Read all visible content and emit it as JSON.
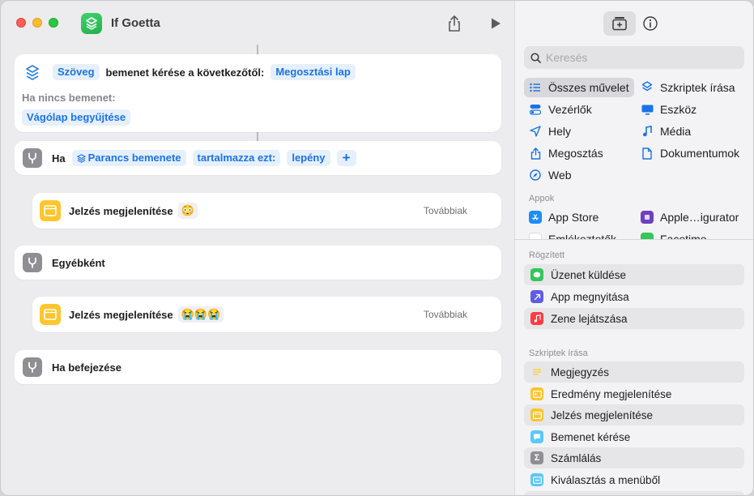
{
  "window": {
    "title": "If Goetta"
  },
  "editor": {
    "ask_input": {
      "type_token": "Szöveg",
      "text": "bemenet kérése a következőtől:",
      "source_token": "Megosztási lap",
      "no_input_label": "Ha nincs bemenet:",
      "no_input_token": "Vágólap begyűjtése"
    },
    "if_block": {
      "label": "Ha",
      "param_token": "Parancs bemenete",
      "condition_token": "tartalmazza ezt:",
      "value_token": "lepény",
      "add_label": "+"
    },
    "alert1": {
      "label": "Jelzés megjelenítése",
      "emoji": "😳",
      "more": "Továbbiak"
    },
    "otherwise": {
      "label": "Egyébként"
    },
    "alert2": {
      "label": "Jelzés megjelenítése",
      "emoji": "😭😭😭",
      "more": "Továbbiak"
    },
    "end_if": {
      "label": "Ha befejezése"
    }
  },
  "sidebar": {
    "search_placeholder": "Keresés",
    "categories": [
      {
        "label": "Összes művelet",
        "icon": "list-icon"
      },
      {
        "label": "Szkriptek írása",
        "icon": "script-icon"
      },
      {
        "label": "Vezérlők",
        "icon": "toggle-icon"
      },
      {
        "label": "Eszköz",
        "icon": "display-icon"
      },
      {
        "label": "Hely",
        "icon": "location-icon"
      },
      {
        "label": "Média",
        "icon": "music-note-icon"
      },
      {
        "label": "Megosztás",
        "icon": "share-icon"
      },
      {
        "label": "Dokumentumok",
        "icon": "document-icon"
      },
      {
        "label": "Web",
        "icon": "compass-icon"
      }
    ],
    "apps_header": "Appok",
    "apps": [
      {
        "label": "App Store",
        "icon": "app-store-icon"
      },
      {
        "label": "Apple…igurator",
        "icon": "configurator-icon"
      },
      {
        "label": "Emlékeztetők",
        "icon": "reminders-icon"
      },
      {
        "label": "Facetime",
        "icon": "facetime-icon"
      }
    ],
    "pinned_header": "Rögzített",
    "pinned": [
      {
        "label": "Üzenet küldése",
        "color": "#34c759"
      },
      {
        "label": "App megnyitása",
        "color": "#5e5ce6"
      },
      {
        "label": "Zene lejátszása",
        "color": "#fc3c44"
      }
    ],
    "scripting_header": "Szkriptek írása",
    "scripting": [
      {
        "label": "Megjegyzés",
        "color": "#f5d04a"
      },
      {
        "label": "Eredmény megjelenítése",
        "color": "#fec62e"
      },
      {
        "label": "Jelzés megjelenítése",
        "color": "#fec62e"
      },
      {
        "label": "Bemenet kérése",
        "color": "#5ac8fa"
      },
      {
        "label": "Számlálás",
        "color": "#8e8e93"
      },
      {
        "label": "Kiválasztás a menüből",
        "color": "#5ac8fa"
      }
    ]
  }
}
